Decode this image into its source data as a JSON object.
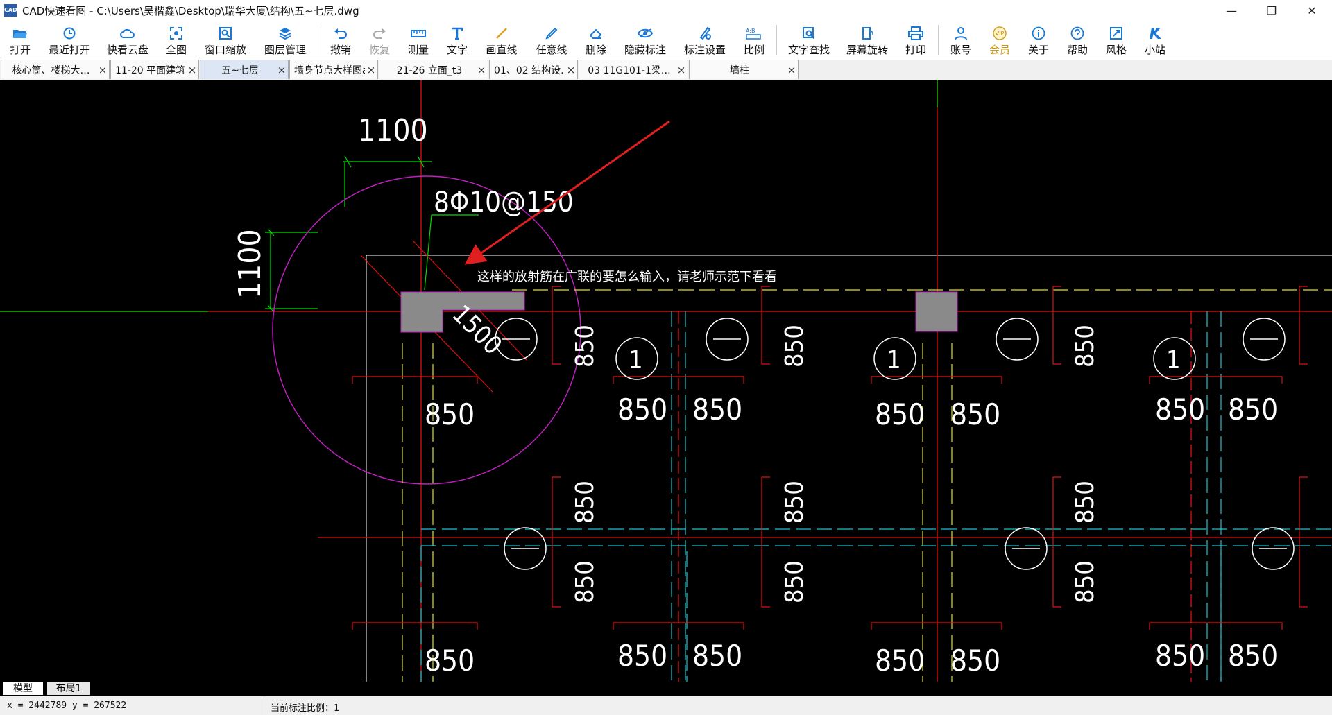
{
  "window": {
    "app_name": "CAD快速看图",
    "title": "CAD快速看图 - C:\\Users\\吴楷鑫\\Desktop\\瑞华大厦\\结构\\五~七层.dwg",
    "min": "—",
    "restore": "❐",
    "close": "✕"
  },
  "toolbar": {
    "items": [
      {
        "label": "打开",
        "icon": "folder-open-icon"
      },
      {
        "label": "最近打开",
        "icon": "history-icon"
      },
      {
        "label": "快看云盘",
        "icon": "cloud-icon"
      },
      {
        "label": "全图",
        "icon": "fit-all-icon"
      },
      {
        "label": "窗口缩放",
        "icon": "zoom-window-icon"
      },
      {
        "label": "图层管理",
        "icon": "layers-icon"
      },
      {
        "label": "撤销",
        "icon": "undo-icon"
      },
      {
        "label": "恢复",
        "icon": "redo-icon",
        "disabled": true
      },
      {
        "label": "测量",
        "icon": "measure-icon"
      },
      {
        "label": "文字",
        "icon": "text-icon"
      },
      {
        "label": "画直线",
        "icon": "line-icon"
      },
      {
        "label": "任意线",
        "icon": "freehand-icon"
      },
      {
        "label": "删除",
        "icon": "eraser-icon"
      },
      {
        "label": "隐藏标注",
        "icon": "eye-icon"
      },
      {
        "label": "标注设置",
        "icon": "annotation-settings-icon"
      },
      {
        "label": "比例",
        "icon": "scale-icon"
      },
      {
        "label": "文字查找",
        "icon": "text-search-icon"
      },
      {
        "label": "屏幕旋转",
        "icon": "rotate-icon"
      },
      {
        "label": "打印",
        "icon": "print-icon"
      },
      {
        "label": "账号",
        "icon": "user-icon"
      },
      {
        "label": "会员",
        "icon": "vip-icon"
      },
      {
        "label": "关于",
        "icon": "info-icon"
      },
      {
        "label": "帮助",
        "icon": "help-icon"
      },
      {
        "label": "风格",
        "icon": "style-icon"
      },
      {
        "label": "小站",
        "icon": "station-icon"
      }
    ],
    "vip_badge": "VIP",
    "scale_badge": "A:B"
  },
  "tabs": [
    {
      "label": "核心筒、楼梯大…",
      "active": false
    },
    {
      "label": "11-20 平面建筑…",
      "active": false
    },
    {
      "label": "五~七层",
      "active": true
    },
    {
      "label": "墙身节点大样图a",
      "active": false
    },
    {
      "label": "21-26 立面_t3",
      "active": false
    },
    {
      "label": "01、02 结构设…",
      "active": false
    },
    {
      "label": "03 11G101-1梁…",
      "active": false
    },
    {
      "label": "墙柱",
      "active": false
    }
  ],
  "tab_close": "×",
  "drawing": {
    "annotation": "这样的放射筋在广联的要怎么输入，请老师示范下看看",
    "dim_top": "1100",
    "dim_left": "1100",
    "rebar": "8Φ10@150",
    "dim_diag": "1500",
    "dim_850": "850",
    "axis_1": "1",
    "colors": {
      "background": "#000000",
      "axis": "#e01010",
      "dim": "#00dd00",
      "circle": "#c020c0",
      "yellow": "#e0e020",
      "cyan": "#20c0d0",
      "white": "#ffffff",
      "arrow": "#e02020"
    }
  },
  "layout_tabs": {
    "model": "模型",
    "layout1": "布局1"
  },
  "status": {
    "coords": "x = 2442789 y = 267522",
    "scale": "当前标注比例：1"
  }
}
